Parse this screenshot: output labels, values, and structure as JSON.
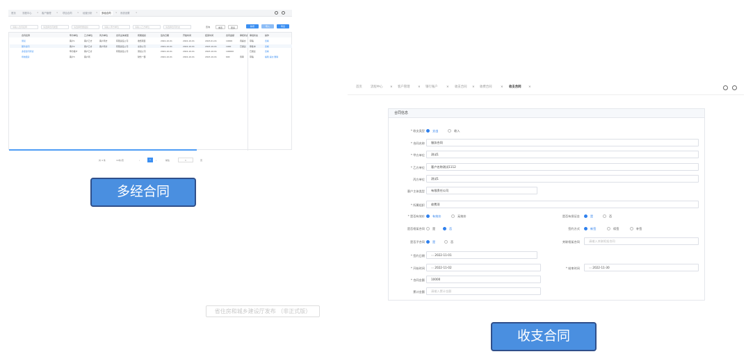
{
  "left_app": {
    "tabs": [
      "首页",
      "流程中心",
      "客户管理",
      "项目合同",
      "经营分析",
      "多经合同",
      "系统设置"
    ],
    "active_tab": "多经合同",
    "filters": [
      "请输入合同名称",
      "请选择合同类型",
      "请选择所属组织",
      "请输入甲方单位",
      "请输入乙方单位",
      "请选择合同状态"
    ],
    "buttons": {
      "search": "查询",
      "reset": "重置",
      "more": "更多",
      "add": "新增",
      "import": "导入",
      "export": "导出"
    },
    "columns": [
      "合同名称",
      "甲方单位",
      "乙方单位",
      "丙方单位",
      "合同主体类型",
      "所属组织",
      "签约日期",
      "开始时间",
      "结束时间",
      "合同金额",
      "审核状态",
      "审批状态",
      "操作"
    ],
    "rows": [
      [
        "测试",
        "客户1",
        "客户乙方",
        "客户丙方",
        "有限责任公司",
        "收费项目",
        "2022-10-01",
        "2022-10-01",
        "2023-01-01",
        "10000",
        "待提交",
        "草稿",
        "查看"
      ],
      [
        "服务合同",
        "客户2",
        "客户乙方",
        "客户丙方",
        "有限责任公司",
        "交款公司",
        "2022-10-01",
        "2022-10-01",
        "2023-10-01",
        "1000",
        "已通过",
        "审批中",
        "查看"
      ],
      [
        "多经合同测试",
        "甲方客户",
        "客户乙方",
        "",
        "有限责任公司",
        "测试公司",
        "2022-10-01",
        "2022-10-01",
        "2023-10-01",
        "100000",
        "",
        "已通过",
        "查看"
      ],
      [
        "场地租赁",
        "客户3",
        "客户丙",
        "",
        "",
        "财务一部",
        "2022-10-01",
        "2022-10-01",
        "2023-10-01",
        "600",
        "待审",
        "草稿",
        "编辑 提交 删除"
      ]
    ],
    "pagination": {
      "total": "共 4 条",
      "size": "10条/页",
      "current": "1",
      "goto": "前往",
      "page": "1",
      "suffix": "页"
    }
  },
  "label_left": "多经合同",
  "label_right": "收支合同",
  "watermark": "省住房和城乡建设厅发布 （非正式版）",
  "right_app": {
    "tabs": [
      "首页",
      "流程中心",
      "客户管理",
      "银行账户",
      "收支合同",
      "收费合同",
      "收支合同"
    ],
    "active_tab": "收支合同",
    "form_title": "合同信息",
    "fields": {
      "type_label": "* 收支类型",
      "type_opt1": "支出",
      "type_opt2": "收入",
      "name_label": "* 合同名称",
      "name_value": "服务合同",
      "partyA_label": "* 甲方单位",
      "partyA_value": "测试1",
      "partyB_label": "* 乙方单位",
      "partyB_value": "客户名称测试1112",
      "partyC_label": "丙方单位",
      "partyC_value": "测试1",
      "subject_label": "客户主体类型",
      "subject_value": "有限责任公司",
      "org_label": "* 所属组织",
      "org_value": "收费项",
      "fixed_label": "* 是否有效价",
      "fixed_opt1": "有效价",
      "fixed_opt2": "无效价",
      "deposit_label": "是否有保证金",
      "deposit_opt1": "是",
      "deposit_opt2": "否",
      "frame_label": "是否框架合同",
      "frame_opt1": "是",
      "frame_opt2": "否",
      "pay_label": "签约方式",
      "pay_opt1": "新签",
      "pay_opt2": "续签",
      "pay_opt3": "补签",
      "sub_label": "是否子合同",
      "sub_opt1": "是",
      "sub_opt2": "否",
      "parent_label": "关联框架合同",
      "parent_placeholder": "请输入关联框架合同",
      "sign_label": "* 签约日期",
      "sign_value": "2022-11-01",
      "start_label": "* 开始时间",
      "start_value": "2022-11-02",
      "end_label": "* 结束时间",
      "end_value": "2022-11-30",
      "amount_label": "* 合同金额",
      "amount_value": "10000",
      "sum_label": "累计金额",
      "sum_placeholder": "请输入累计金额"
    }
  },
  "colors": {
    "primary": "#3b8ff2",
    "label_bg": "#4a8fe0",
    "label_border": "#2f4f8a"
  }
}
